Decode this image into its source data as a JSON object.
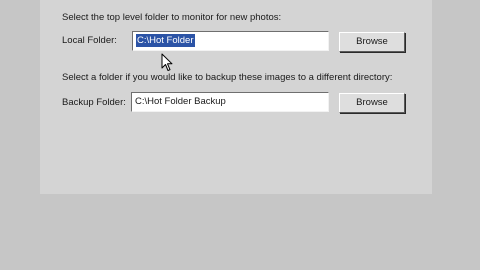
{
  "local": {
    "instruction": "Select the top level folder to monitor for new photos:",
    "label": "Local Folder:",
    "value": "C:\\Hot Folder",
    "browse_label": "Browse"
  },
  "backup": {
    "instruction": "Select a folder if you would like to backup these images to a different directory:",
    "label": "Backup Folder:",
    "value": "C:\\Hot Folder Backup",
    "browse_label": "Browse"
  },
  "icons": {
    "cursor": "mouse-pointer-icon"
  }
}
